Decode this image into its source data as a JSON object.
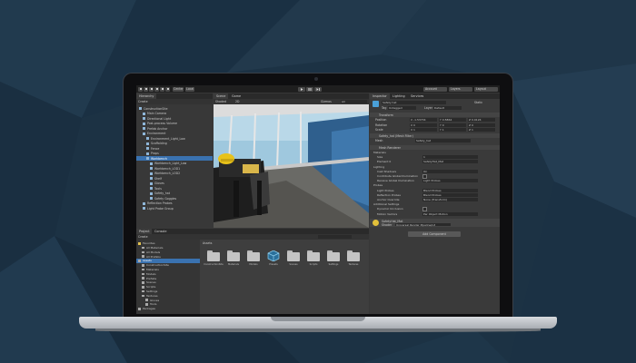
{
  "app": {
    "toolbar": {
      "tools": [
        "hand-tool",
        "move-tool",
        "rotate-tool",
        "scale-tool",
        "rect-tool",
        "transform-tool"
      ],
      "pivot_label": "Center",
      "space_label": "Local",
      "play_icons": [
        "play-icon",
        "pause-icon",
        "step-icon"
      ],
      "right_buttons": [
        "Account",
        "Layers",
        "Layout"
      ]
    },
    "hierarchy": {
      "tab": "Hierarchy",
      "create_label": "Create",
      "items": [
        {
          "label": "ConstructionSite",
          "depth": 0,
          "selected": false
        },
        {
          "label": "Main Camera",
          "depth": 1,
          "selected": false
        },
        {
          "label": "Directional Light",
          "depth": 1,
          "selected": false
        },
        {
          "label": "Post-process Volume",
          "depth": 1,
          "selected": false
        },
        {
          "label": "Prefab Anchor",
          "depth": 1,
          "selected": false
        },
        {
          "label": "Environment",
          "depth": 1,
          "selected": false
        },
        {
          "label": "Environment_Light_Low",
          "depth": 2,
          "selected": false
        },
        {
          "label": "Scaffolding",
          "depth": 2,
          "selected": false
        },
        {
          "label": "Fence",
          "depth": 2,
          "selected": false
        },
        {
          "label": "Props",
          "depth": 2,
          "selected": false
        },
        {
          "label": "Workbench",
          "depth": 2,
          "selected": true
        },
        {
          "label": "Workbench_Light_Low",
          "depth": 3,
          "selected": false
        },
        {
          "label": "Workbench_LOD1",
          "depth": 3,
          "selected": false
        },
        {
          "label": "Workbench_LOD2",
          "depth": 3,
          "selected": false
        },
        {
          "label": "Shelf",
          "depth": 3,
          "selected": false
        },
        {
          "label": "Gloves",
          "depth": 3,
          "selected": false
        },
        {
          "label": "Tools",
          "depth": 3,
          "selected": false
        },
        {
          "label": "Safety_hat",
          "depth": 3,
          "selected": false
        },
        {
          "label": "Safety Goggles",
          "depth": 3,
          "selected": false
        },
        {
          "label": "Reflection Probes",
          "depth": 1,
          "selected": false
        },
        {
          "label": "Light Probe Group",
          "depth": 1,
          "selected": false
        }
      ]
    },
    "scene": {
      "tabs": [
        "Scene",
        "Game"
      ],
      "shading_label": "Shaded",
      "mode_label": "2D",
      "gizmos_label": "Gizmos",
      "search_placeholder": "All"
    },
    "inspector": {
      "tabs": [
        "Inspector",
        "Lighting",
        "Services"
      ],
      "object_name": "Safety hat",
      "static_label": "Static",
      "tag_label": "Tag",
      "tag_value": "Untagged",
      "layer_label": "Layer",
      "layer_value": "Default",
      "transform": {
        "title": "Transform",
        "position": {
          "label": "Position",
          "x": "X -1.53734",
          "y": "Y 0.5864",
          "z": "Z 0.9124"
        },
        "rotation": {
          "label": "Rotation",
          "x": "X 0",
          "y": "Y 0",
          "z": "Z 0"
        },
        "scale": {
          "label": "Scale",
          "x": "X 1",
          "y": "Y 1",
          "z": "Z 1"
        }
      },
      "mesh_filter": {
        "title": "Safety_hat (Mesh Filter)",
        "mesh_label": "Mesh",
        "mesh_value": "Safety_hat"
      },
      "mesh_renderer": {
        "title": "Mesh Renderer",
        "materials_label": "Materials",
        "size_label": "Size",
        "size_value": "1",
        "element_label": "Element 0",
        "element_value": "SafetyHat_Mat",
        "lighting_label": "Lighting",
        "cast_shadows_label": "Cast Shadows",
        "cast_shadows_value": "On",
        "contribute_gi_label": "Contribute Global Illumination",
        "receive_gi_label": "Receive Global Illumination",
        "receive_gi_value": "Light Probes",
        "probes_label": "Probes",
        "light_probes_label": "Light Probes",
        "light_probes_value": "Blend Probes",
        "reflection_probes_label": "Reflection Probes",
        "reflection_probes_value": "Blend Probes",
        "anchor_override_label": "Anchor Override",
        "anchor_override_value": "None (Transform)",
        "additional_label": "Additional Settings",
        "dynamic_occlusion_label": "Dynamic Occlusion",
        "motion_vectors_label": "Motion Vectors",
        "motion_vectors_value": "Per Object Motion"
      },
      "material": {
        "name": "SafetyHat_Mat",
        "shader_label": "Shader",
        "shader_value": "Universal Render Pipeline/Lit"
      },
      "add_component_label": "Add Component"
    },
    "project": {
      "tabs": [
        "Project",
        "Console"
      ],
      "create_label": "Create",
      "tree": [
        {
          "label": "Favorites",
          "depth": 0,
          "selected": false
        },
        {
          "label": "All Materials",
          "depth": 1,
          "selected": false
        },
        {
          "label": "All Models",
          "depth": 1,
          "selected": false
        },
        {
          "label": "All Prefabs",
          "depth": 1,
          "selected": false
        },
        {
          "label": "Assets",
          "depth": 0,
          "selected": true
        },
        {
          "label": "ConstructionSite",
          "depth": 1,
          "selected": false
        },
        {
          "label": "Materials",
          "depth": 1,
          "selected": false
        },
        {
          "label": "Models",
          "depth": 1,
          "selected": false
        },
        {
          "label": "Prefabs",
          "depth": 1,
          "selected": false
        },
        {
          "label": "Scenes",
          "depth": 1,
          "selected": false
        },
        {
          "label": "Scripts",
          "depth": 1,
          "selected": false
        },
        {
          "label": "Settings",
          "depth": 1,
          "selected": false
        },
        {
          "label": "Textures",
          "depth": 1,
          "selected": false
        },
        {
          "label": "Gloves",
          "depth": 2,
          "selected": false
        },
        {
          "label": "Tools",
          "depth": 2,
          "selected": false
        },
        {
          "label": "Packages",
          "depth": 0,
          "selected": false
        }
      ],
      "breadcrumb": "Assets",
      "folders": [
        "ConstructionSite",
        "Materials",
        "Models",
        "Presets",
        "Scenes",
        "Scripts",
        "Settings",
        "Textures"
      ]
    }
  },
  "colors": {
    "background": "#1c3244",
    "editor_bg": "#383838",
    "selection": "#3a72b0",
    "scene_sky": "#9fc8de"
  }
}
